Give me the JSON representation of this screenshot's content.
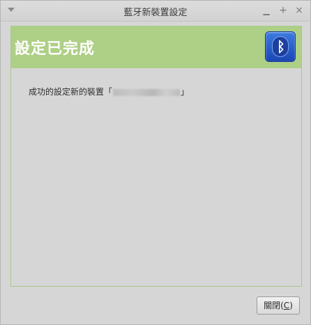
{
  "window": {
    "title": "藍牙新裝置設定"
  },
  "header": {
    "title": "設定已完成",
    "icon": "bluetooth-icon"
  },
  "message": {
    "prefix": "成功的設定新的裝置「",
    "device_name": "",
    "suffix": "」"
  },
  "buttons": {
    "close_label": "關閉(",
    "close_mnemonic": "C",
    "close_end": ")"
  },
  "colors": {
    "header_band": "#aecf86",
    "frame_border": "#a8c98c",
    "bluetooth_blue": "#2a5bc8"
  }
}
